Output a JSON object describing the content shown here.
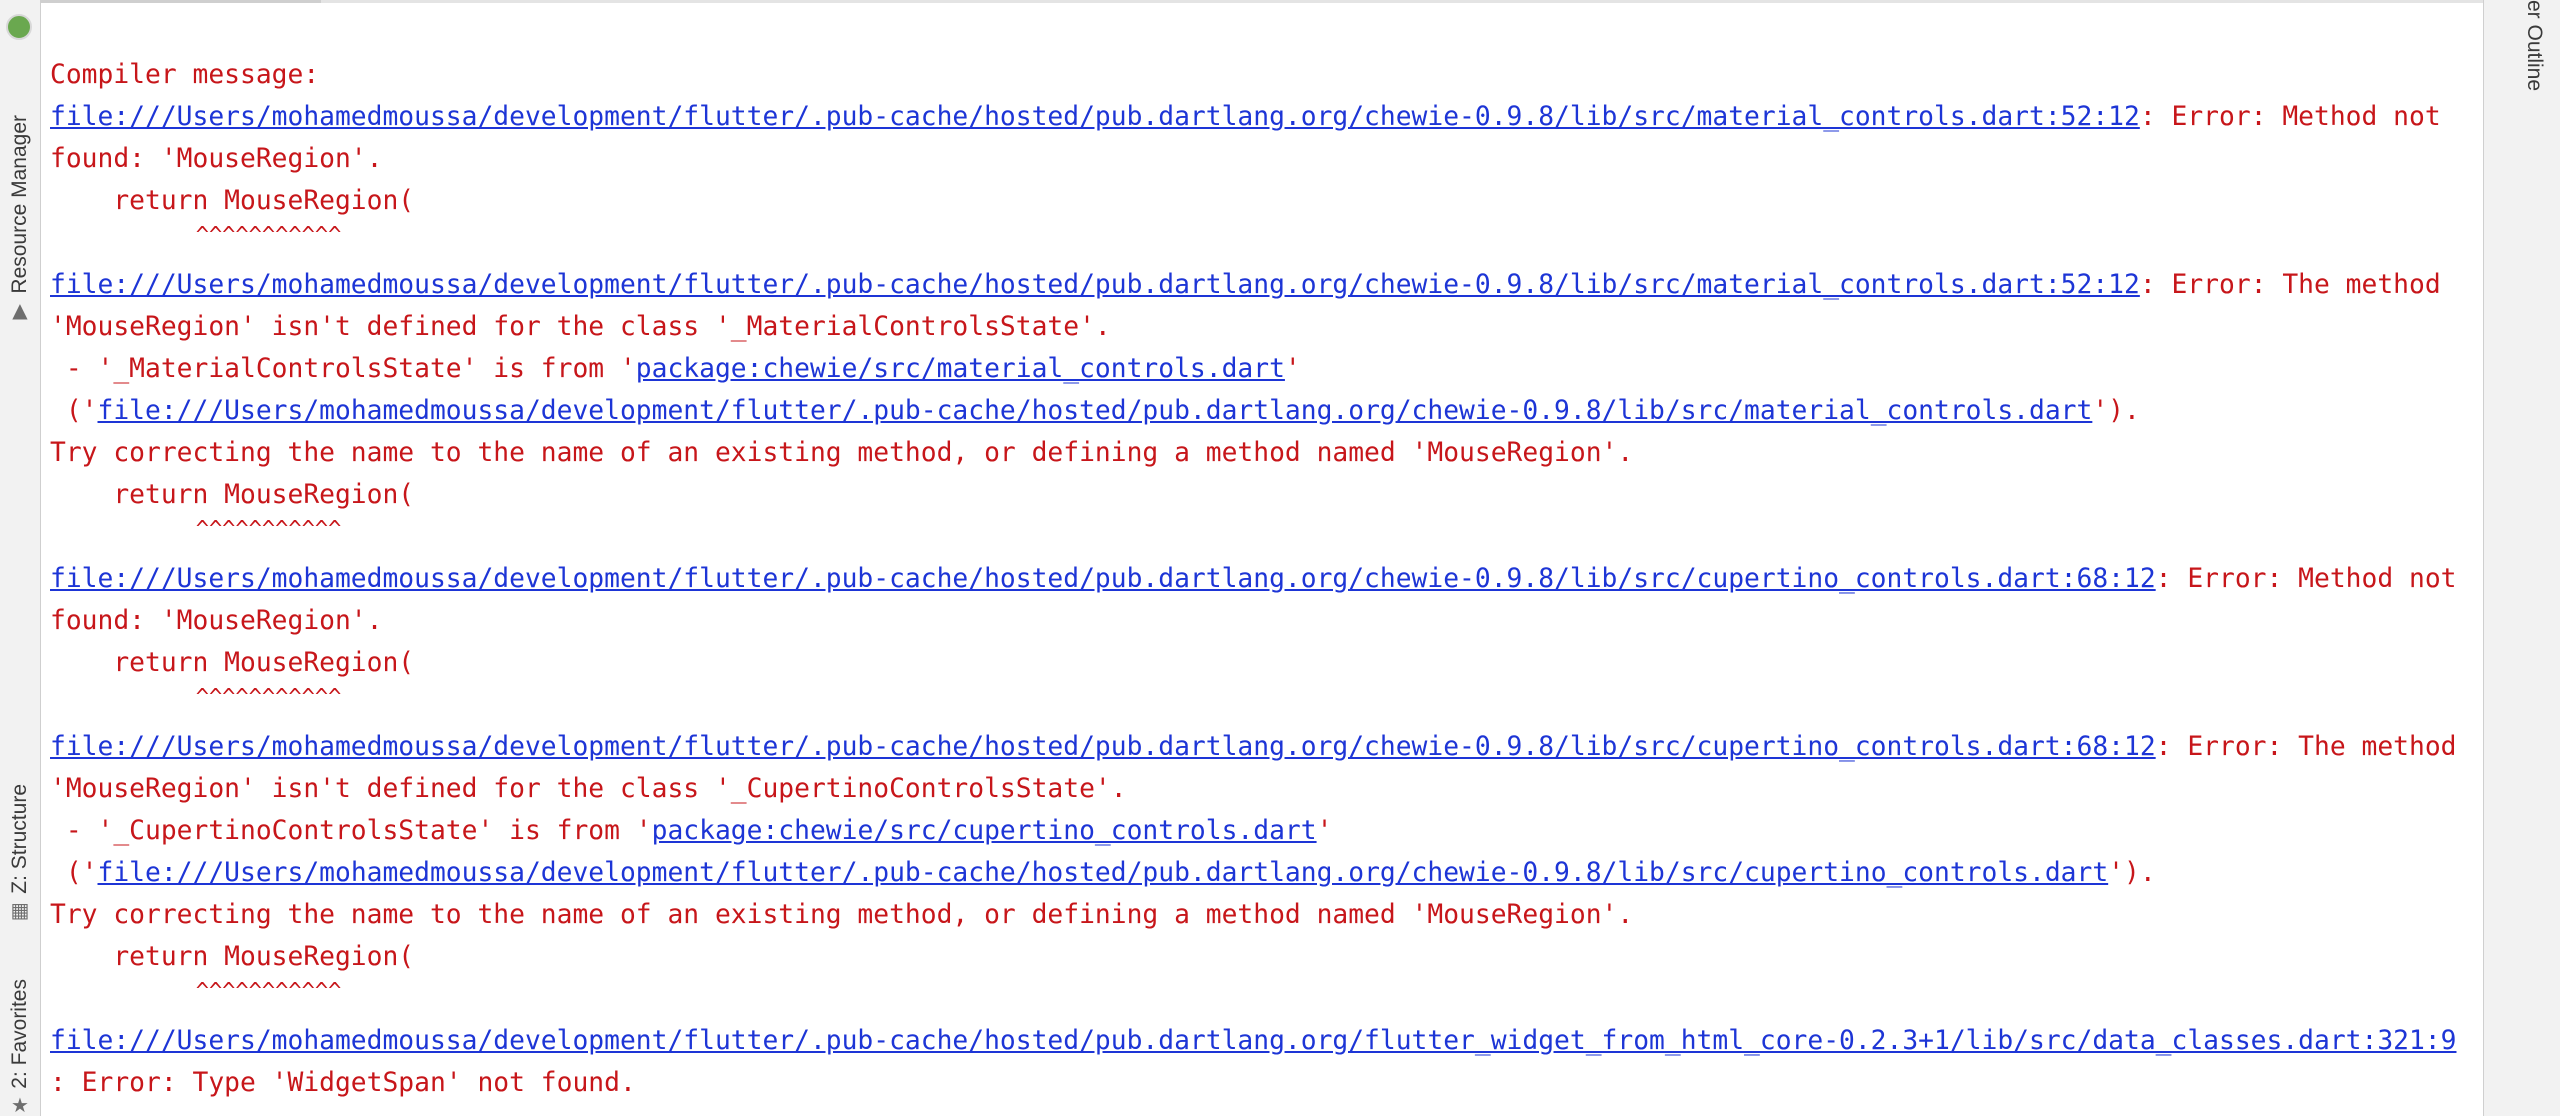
{
  "left_panel": {
    "tabs": [
      {
        "label": "Resource Manager"
      },
      {
        "label": "Z: Structure"
      },
      {
        "label": "2: Favorites"
      }
    ]
  },
  "right_panel": {
    "label": "er Outline"
  },
  "console": {
    "lines": [
      {
        "parts": [
          {
            "t": "Compiler message:"
          }
        ]
      },
      {
        "parts": [
          {
            "t": "file:///Users/mohamedmoussa/development/flutter/.pub-cache/hosted/pub.dartlang.org/chewie-0.9.8/lib/src/material_controls.dart:52:12",
            "link": true
          },
          {
            "t": ": Error: Method not"
          }
        ]
      },
      {
        "parts": [
          {
            "t": "found: 'MouseRegion'."
          }
        ]
      },
      {
        "parts": [
          {
            "t": "    return MouseRegion("
          }
        ]
      },
      {
        "carets": true,
        "parts": [
          {
            "t": "           ^^^^^^^^^^^"
          }
        ]
      },
      {
        "parts": [
          {
            "t": "file:///Users/mohamedmoussa/development/flutter/.pub-cache/hosted/pub.dartlang.org/chewie-0.9.8/lib/src/material_controls.dart:52:12",
            "link": true
          },
          {
            "t": ": Error: The method"
          }
        ]
      },
      {
        "parts": [
          {
            "t": "'MouseRegion' isn't defined for the class '_MaterialControlsState'."
          }
        ]
      },
      {
        "parts": [
          {
            "t": " - '_MaterialControlsState' is from '"
          },
          {
            "t": "package:chewie/src/material_controls.dart",
            "link": true
          },
          {
            "t": "'"
          }
        ]
      },
      {
        "parts": [
          {
            "t": " ('"
          },
          {
            "t": "file:///Users/mohamedmoussa/development/flutter/.pub-cache/hosted/pub.dartlang.org/chewie-0.9.8/lib/src/material_controls.dart",
            "link": true
          },
          {
            "t": "')."
          }
        ]
      },
      {
        "parts": [
          {
            "t": "Try correcting the name to the name of an existing method, or defining a method named 'MouseRegion'."
          }
        ]
      },
      {
        "parts": [
          {
            "t": "    return MouseRegion("
          }
        ]
      },
      {
        "carets": true,
        "parts": [
          {
            "t": "           ^^^^^^^^^^^"
          }
        ]
      },
      {
        "parts": [
          {
            "t": "file:///Users/mohamedmoussa/development/flutter/.pub-cache/hosted/pub.dartlang.org/chewie-0.9.8/lib/src/cupertino_controls.dart:68:12",
            "link": true
          },
          {
            "t": ": Error: Method not"
          }
        ]
      },
      {
        "parts": [
          {
            "t": "found: 'MouseRegion'."
          }
        ]
      },
      {
        "parts": [
          {
            "t": "    return MouseRegion("
          }
        ]
      },
      {
        "carets": true,
        "parts": [
          {
            "t": "           ^^^^^^^^^^^"
          }
        ]
      },
      {
        "parts": [
          {
            "t": "file:///Users/mohamedmoussa/development/flutter/.pub-cache/hosted/pub.dartlang.org/chewie-0.9.8/lib/src/cupertino_controls.dart:68:12",
            "link": true
          },
          {
            "t": ": Error: The method"
          }
        ]
      },
      {
        "parts": [
          {
            "t": "'MouseRegion' isn't defined for the class '_CupertinoControlsState'."
          }
        ]
      },
      {
        "parts": [
          {
            "t": " - '_CupertinoControlsState' is from '"
          },
          {
            "t": "package:chewie/src/cupertino_controls.dart",
            "link": true
          },
          {
            "t": "'"
          }
        ]
      },
      {
        "parts": [
          {
            "t": " ('"
          },
          {
            "t": "file:///Users/mohamedmoussa/development/flutter/.pub-cache/hosted/pub.dartlang.org/chewie-0.9.8/lib/src/cupertino_controls.dart",
            "link": true
          },
          {
            "t": "')."
          }
        ]
      },
      {
        "parts": [
          {
            "t": "Try correcting the name to the name of an existing method, or defining a method named 'MouseRegion'."
          }
        ]
      },
      {
        "parts": [
          {
            "t": "    return MouseRegion("
          }
        ]
      },
      {
        "carets": true,
        "parts": [
          {
            "t": "           ^^^^^^^^^^^"
          }
        ]
      },
      {
        "parts": [
          {
            "t": "file:///Users/mohamedmoussa/development/flutter/.pub-cache/hosted/pub.dartlang.org/flutter_widget_from_html_core-0.2.3+1/lib/src/data_classes.dart:321:9",
            "link": true
          }
        ]
      },
      {
        "parts": [
          {
            "t": ": Error: Type 'WidgetSpan' not found."
          }
        ]
      }
    ]
  },
  "colors": {
    "error_text": "#c7161a",
    "link": "#1d35d6",
    "background": "#ffffff",
    "tool_strip": "#f2f2f2"
  }
}
